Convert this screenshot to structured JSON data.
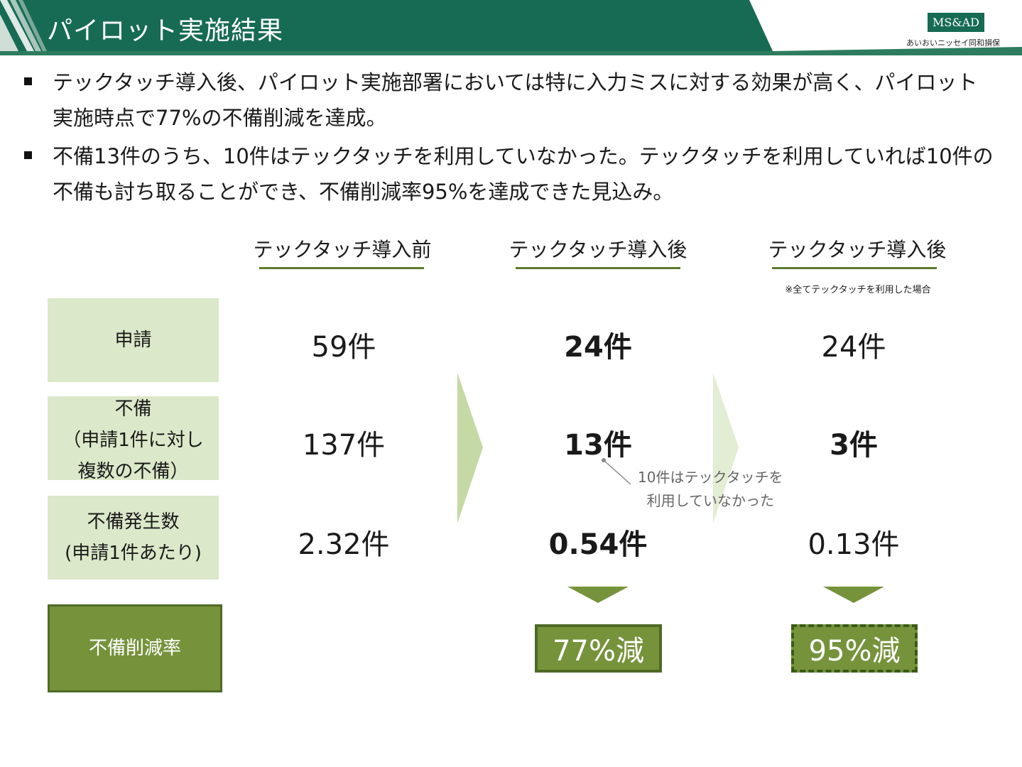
{
  "header": {
    "title": "パイロット実施結果",
    "logo_text": "MS&AD",
    "logo_subtext": "あいおいニッセイ同和損保",
    "colors": {
      "band": "#176b55",
      "accent_line": "#2e7c5f"
    }
  },
  "bullets": [
    "テックタッチ導入後、パイロット実施部署においては特に入力ミスに対する効果が高く、パイロット実施時点で77%の不備削減を達成。",
    "不備13件のうち、10件はテックタッチを利用していなかった。テックタッチを利用していれば10件の不備も討ち取ることができ、不備削減率95%を達成できた見込み。"
  ],
  "columns": [
    {
      "header": "テックタッチ導入前"
    },
    {
      "header": "テックタッチ導入後"
    },
    {
      "header": "テックタッチ導入後",
      "note": "※全てテックタッチを利用した場合"
    }
  ],
  "rows": [
    {
      "label": "申請",
      "values": [
        "59件",
        "24件",
        "24件"
      ]
    },
    {
      "label": "不備\n（申請1件に対し\n複数の不備）",
      "values": [
        "137件",
        "13件",
        "3件"
      ]
    },
    {
      "label": "不備発生数\n(申請1件あたり)",
      "values": [
        "2.32件",
        "0.54件",
        "0.13件"
      ]
    }
  ],
  "reduction": {
    "label": "不備削減率",
    "values": [
      "77%減",
      "95%減"
    ]
  },
  "callout": {
    "line1": "10件はテックタッチを",
    "line2": "利用していなかった"
  },
  "colors": {
    "label_fill": "#dbe8c9",
    "dark_green": "#76933c",
    "arrow_light": "#c5d9a5",
    "arrow_pale": "#e2edd3"
  }
}
